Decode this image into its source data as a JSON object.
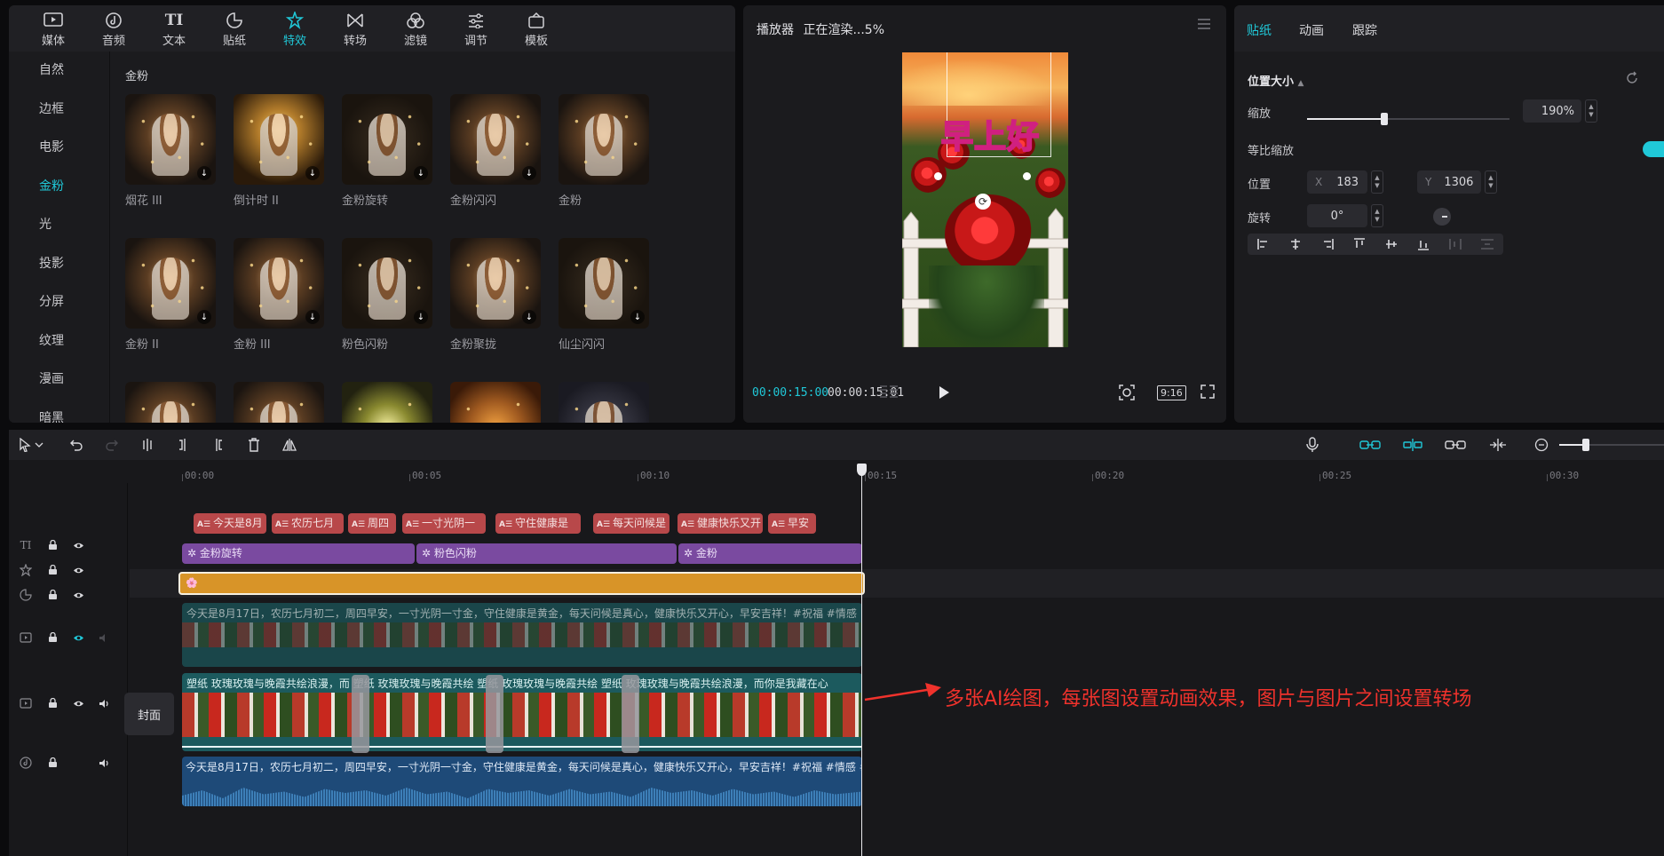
{
  "media_tabs": [
    {
      "label": "媒体",
      "icon": "media-icon",
      "active": false
    },
    {
      "label": "音频",
      "icon": "audio-icon",
      "active": false
    },
    {
      "label": "文本",
      "icon": "text-icon",
      "active": false
    },
    {
      "label": "贴纸",
      "icon": "sticker-icon",
      "active": false
    },
    {
      "label": "特效",
      "icon": "effects-icon",
      "active": true
    },
    {
      "label": "转场",
      "icon": "transition-icon",
      "active": false
    },
    {
      "label": "滤镜",
      "icon": "filter-icon",
      "active": false
    },
    {
      "label": "调节",
      "icon": "adjust-icon",
      "active": false
    },
    {
      "label": "模板",
      "icon": "template-icon",
      "active": false
    }
  ],
  "categories": [
    "自然",
    "边框",
    "电影",
    "金粉",
    "光",
    "投影",
    "分屏",
    "纹理",
    "漫画",
    "暗黑"
  ],
  "active_category": "金粉",
  "grid_title": "金粉",
  "effects": [
    "烟花 III",
    "倒计时 II",
    "金粉旋转",
    "金粉闪闪",
    "金粉",
    "金粉 II",
    "金粉 III",
    "粉色闪粉",
    "金粉聚拢",
    "仙尘闪闪",
    "",
    "",
    "",
    "",
    ""
  ],
  "player": {
    "title": "播放器",
    "status": "正在渲染...5%",
    "sticker_text": "早上好",
    "current_time": "00:00:15:00",
    "total_time": "00:00:15:01",
    "ratio": "9:16"
  },
  "props": {
    "tabs": [
      "贴纸",
      "动画",
      "跟踪"
    ],
    "section": "位置大小",
    "scale_label": "缩放",
    "scale_value": "190%",
    "scale_fraction": 0.38,
    "uniform_label": "等比缩放",
    "position_label": "位置",
    "x_label": "X",
    "x_value": "183",
    "y_label": "Y",
    "y_value": "1306",
    "rotate_label": "旋转",
    "rotate_value": "0°"
  },
  "timeline": {
    "ticks": [
      "00:00",
      "00:05",
      "00:10",
      "00:15",
      "00:20",
      "00:25",
      "00:30"
    ],
    "text_clips": [
      "今天是8月",
      "农历七月",
      "周四",
      "一寸光阴一",
      "守住健康是",
      "每天问候是",
      "健康快乐又开",
      "早安"
    ],
    "effect_clips": [
      "金粉旋转",
      "粉色闪粉",
      "金粉"
    ],
    "sticker_clip": "🌸",
    "overlay_caption": "今天是8月17日，农历七月初二，周四早安，一寸光阴一寸金，守住健康是黄金，每天问候是真心，健康快乐又开心，早安吉祥！#祝福 #情感",
    "main_caption": "塑纸  玫瑰玫瑰与晚霞共绘浪漫，而  塑纸  玫瑰玫瑰与晚霞共绘  塑纸  玫瑰玫瑰与晚霞共绘  塑纸  玫瑰玫瑰与晚霞共绘浪漫，而你是我藏在心",
    "audio_caption": "今天是8月17日，农历七月初二，周四早安，一寸光阴一寸金，守住健康是黄金，每天问候是真心，健康快乐又开心，早安吉祥！#祝福 #情感 #早",
    "cover_label": "封面"
  },
  "annotation": "多张AI绘图，每张图设置动画效果，图片与图片之间设置转场",
  "colors": {
    "accent": "#20c8d8",
    "text_clip": "#b8484a",
    "effect_clip": "#7a4aa0",
    "sticker_clip": "#d89428",
    "video_clip": "#1c5a5e",
    "audio_clip": "#1e4a78",
    "annotation": "#f0322c"
  }
}
